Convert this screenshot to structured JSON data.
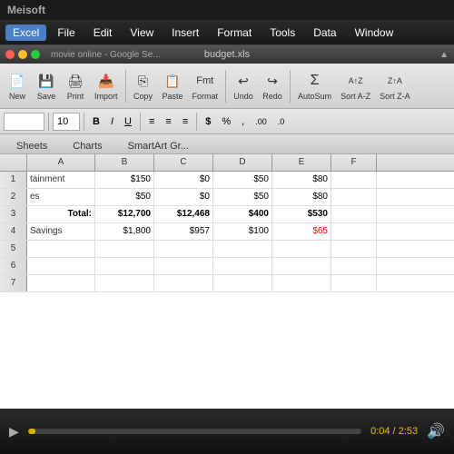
{
  "titleBar": {
    "text": "Meisoft"
  },
  "menuBar": {
    "items": [
      {
        "label": "Excel",
        "active": true
      },
      {
        "label": "File"
      },
      {
        "label": "Edit"
      },
      {
        "label": "View"
      },
      {
        "label": "Insert"
      },
      {
        "label": "Format"
      },
      {
        "label": "Tools"
      },
      {
        "label": "Data"
      },
      {
        "label": "Window"
      }
    ]
  },
  "windowTitle": {
    "filename": "budget.xls",
    "subtitle": "movie online - Google Se..."
  },
  "toolbar": {
    "buttons": [
      {
        "icon": "🆕",
        "label": "New"
      },
      {
        "icon": "💾",
        "label": "Save"
      },
      {
        "icon": "🖨",
        "label": "Print"
      },
      {
        "icon": "📥",
        "label": "Import"
      },
      {
        "icon": "©",
        "label": "Copy"
      },
      {
        "icon": "📋",
        "label": "Paste"
      },
      {
        "icon": "F",
        "label": "Format"
      },
      {
        "icon": "↩",
        "label": "Undo"
      },
      {
        "icon": "↪",
        "label": "Redo"
      },
      {
        "icon": "Σ",
        "label": "AutoSum"
      },
      {
        "icon": "↑A↓Z",
        "label": "Sort A-Z"
      },
      {
        "icon": "↑Z↓A",
        "label": "Sort Z-A"
      }
    ]
  },
  "formatBar": {
    "cellRef": "",
    "fontSize": "10",
    "bold": "B",
    "italic": "I",
    "underline": "U",
    "alignLeft": "≡",
    "alignCenter": "≡",
    "alignRight": "≡",
    "currency": "$",
    "percent": "%",
    "comma": ",",
    "decIncrease": ".00",
    "decDecrease": ".0"
  },
  "ribbonTabs": [
    "Sheets",
    "Charts",
    "SmartArt Gr..."
  ],
  "columns": {
    "headers": [
      "A",
      "B",
      "C",
      "D",
      "E",
      "F"
    ]
  },
  "rows": [
    {
      "rowNum": "1",
      "cells": [
        {
          "value": "tainment",
          "class": "cell-label"
        },
        {
          "value": "$150",
          "class": "cell-right"
        },
        {
          "value": "$0",
          "class": "cell-right"
        },
        {
          "value": "$50",
          "class": "cell-right"
        },
        {
          "value": "$80",
          "class": "cell-right"
        },
        {
          "value": "",
          "class": ""
        }
      ]
    },
    {
      "rowNum": "2",
      "cells": [
        {
          "value": "es",
          "class": "cell-label"
        },
        {
          "value": "$50",
          "class": "cell-right"
        },
        {
          "value": "$0",
          "class": "cell-right"
        },
        {
          "value": "$50",
          "class": "cell-right"
        },
        {
          "value": "$80",
          "class": "cell-right"
        },
        {
          "value": "",
          "class": ""
        }
      ]
    },
    {
      "rowNum": "3",
      "cells": [
        {
          "value": "Total:",
          "class": "cell-bold cell-right"
        },
        {
          "value": "$12,700",
          "class": "cell-right cell-bold"
        },
        {
          "value": "$12,468",
          "class": "cell-right cell-bold"
        },
        {
          "value": "$400",
          "class": "cell-right cell-bold"
        },
        {
          "value": "$530",
          "class": "cell-right cell-bold"
        },
        {
          "value": "",
          "class": ""
        }
      ]
    },
    {
      "rowNum": "4",
      "cells": [
        {
          "value": "Savings",
          "class": "cell-label"
        },
        {
          "value": "$1,800",
          "class": "cell-right"
        },
        {
          "value": "$957",
          "class": "cell-right"
        },
        {
          "value": "$100",
          "class": "cell-right"
        },
        {
          "value": "$65",
          "class": "cell-right cell-red"
        },
        {
          "value": "",
          "class": ""
        }
      ]
    },
    {
      "rowNum": "5",
      "cells": [
        {
          "value": "",
          "class": ""
        },
        {
          "value": "",
          "class": ""
        },
        {
          "value": "",
          "class": ""
        },
        {
          "value": "",
          "class": ""
        },
        {
          "value": "",
          "class": ""
        },
        {
          "value": "",
          "class": ""
        }
      ]
    },
    {
      "rowNum": "6",
      "cells": [
        {
          "value": "",
          "class": ""
        },
        {
          "value": "",
          "class": ""
        },
        {
          "value": "",
          "class": ""
        },
        {
          "value": "",
          "class": ""
        },
        {
          "value": "",
          "class": ""
        },
        {
          "value": "",
          "class": ""
        }
      ]
    },
    {
      "rowNum": "7",
      "cells": [
        {
          "value": "",
          "class": ""
        },
        {
          "value": "",
          "class": ""
        },
        {
          "value": "",
          "class": ""
        },
        {
          "value": "",
          "class": ""
        },
        {
          "value": "",
          "class": ""
        },
        {
          "value": "",
          "class": ""
        }
      ]
    }
  ],
  "videoBar": {
    "time": "0:04 / 2:53",
    "progressPercent": 2.3
  },
  "colors": {
    "accent": "#e8c000",
    "menuActive": "#4a7fc1",
    "background": "#1a1a1a"
  }
}
